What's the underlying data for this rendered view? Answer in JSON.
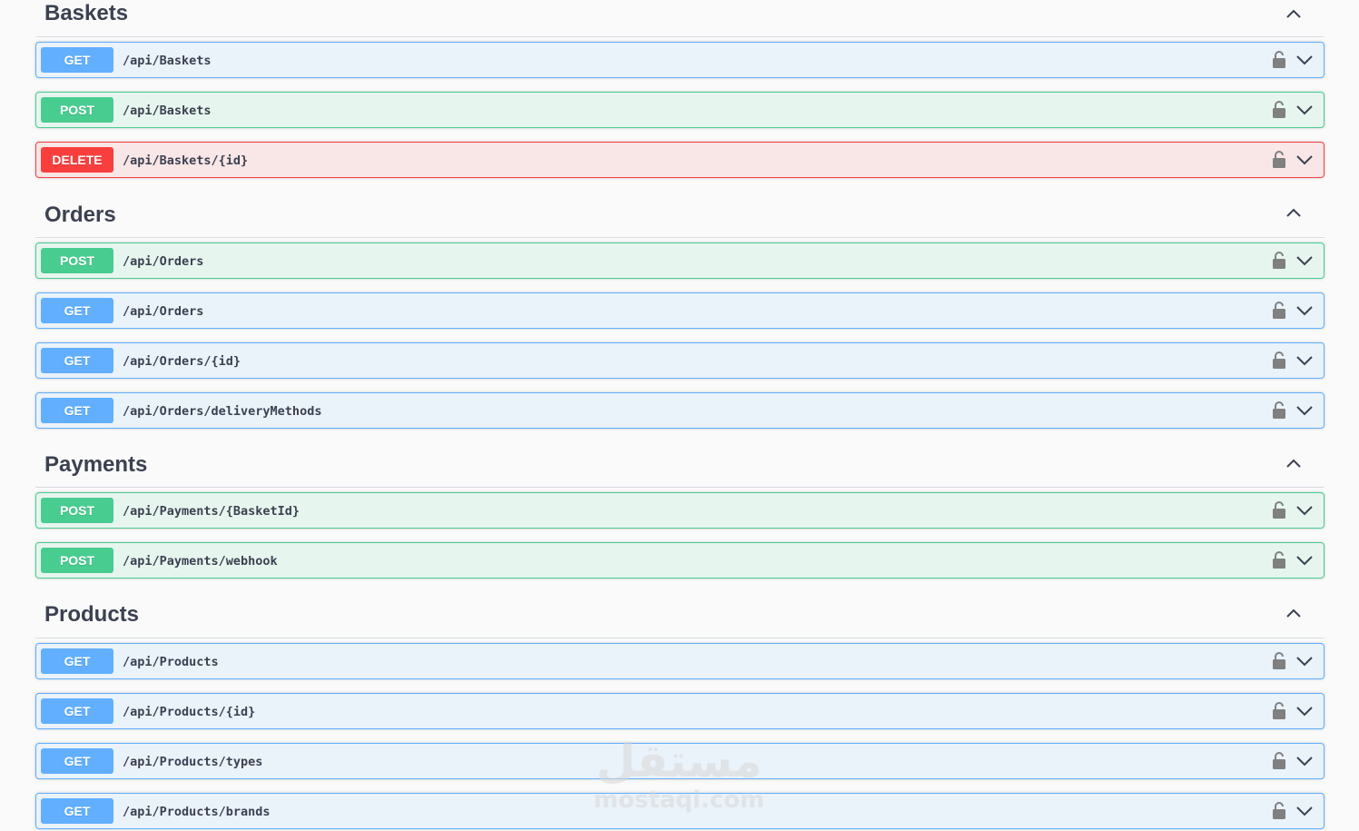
{
  "colors": {
    "get": "#61affe",
    "post": "#49cc90",
    "delete": "#f93e3e",
    "text": "#3b4151"
  },
  "sections": [
    {
      "title": "Baskets",
      "operations": [
        {
          "method": "GET",
          "path": "/api/Baskets"
        },
        {
          "method": "POST",
          "path": "/api/Baskets"
        },
        {
          "method": "DELETE",
          "path": "/api/Baskets/{id}"
        }
      ]
    },
    {
      "title": "Orders",
      "operations": [
        {
          "method": "POST",
          "path": "/api/Orders"
        },
        {
          "method": "GET",
          "path": "/api/Orders"
        },
        {
          "method": "GET",
          "path": "/api/Orders/{id}"
        },
        {
          "method": "GET",
          "path": "/api/Orders/deliveryMethods"
        }
      ]
    },
    {
      "title": "Payments",
      "operations": [
        {
          "method": "POST",
          "path": "/api/Payments/{BasketId}"
        },
        {
          "method": "POST",
          "path": "/api/Payments/webhook"
        }
      ]
    },
    {
      "title": "Products",
      "operations": [
        {
          "method": "GET",
          "path": "/api/Products"
        },
        {
          "method": "GET",
          "path": "/api/Products/{id}"
        },
        {
          "method": "GET",
          "path": "/api/Products/types"
        },
        {
          "method": "GET",
          "path": "/api/Products/brands"
        }
      ]
    }
  ],
  "icons": {
    "collapse": "chevron-up-icon",
    "expand": "chevron-down-icon",
    "auth": "lock-icon"
  },
  "watermark": {
    "arabic": "مستقل",
    "latin": "mostaqi.com"
  }
}
